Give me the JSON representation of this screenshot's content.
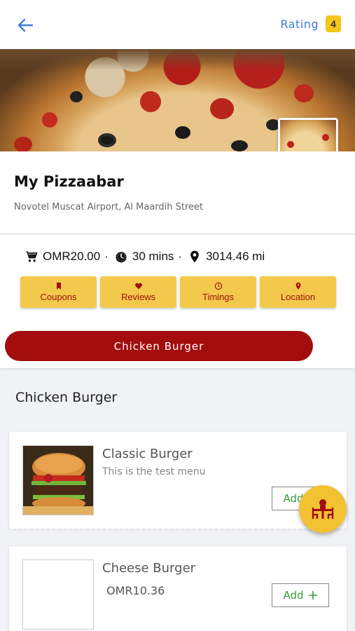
{
  "header": {
    "rating_label": "Rating",
    "rating_value": "4"
  },
  "restaurant": {
    "name": "My Pizzaabar",
    "address": "Novotel Muscat Airport, Al Maardih Street"
  },
  "meta": {
    "min_order": "OMR20.00",
    "delivery_time": "30 mins",
    "distance": "3014.46 mi",
    "separator": "·"
  },
  "actions": [
    {
      "label": "Coupons",
      "icon": "bookmark-icon"
    },
    {
      "label": "Reviews",
      "icon": "heart-icon"
    },
    {
      "label": "Timings",
      "icon": "clock-icon"
    },
    {
      "label": "Location",
      "icon": "location-pin-icon"
    }
  ],
  "category_button": "Chicken Burger",
  "section_title": "Chicken Burger",
  "menu_items": [
    {
      "name": "Classic Burger",
      "description": "This is the test menu",
      "add_label": "Add"
    },
    {
      "name": "Cheese Burger",
      "price": "OMR10.36",
      "add_label": "Add"
    }
  ],
  "colors": {
    "accent_yellow": "#f2c94c",
    "brand_red": "#a30d0d",
    "link_blue": "#3b7ddd",
    "add_green": "#3a9b3a"
  }
}
